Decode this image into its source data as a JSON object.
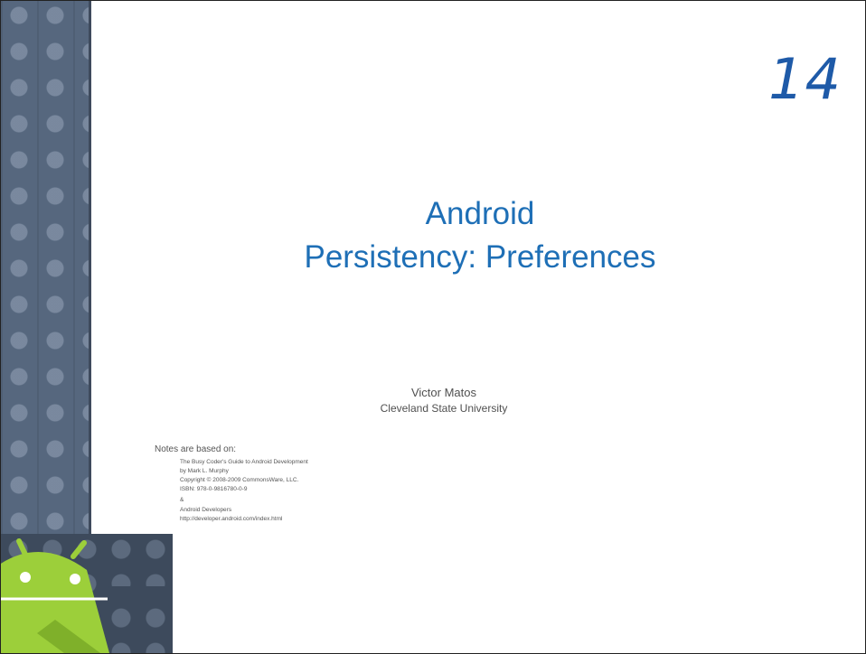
{
  "slide_number": "14",
  "title_line1": "Android",
  "title_line2": "Persistency:  Preferences",
  "author": "Victor Matos",
  "affiliation": "Cleveland State University",
  "notes_heading": "Notes are based on:",
  "notes_lines": [
    "The Busy Coder's Guide to Android Development",
    "by Mark L. Murphy",
    "Copyright © 2008-2009 CommonsWare, LLC.",
    "ISBN: 978-0-9816780-0-9",
    "&",
    "Android Developers",
    "http://developer.android.com/index.html"
  ],
  "logo_text": "android",
  "colors": {
    "title": "#1e6fb6",
    "number": "#1e5aa8",
    "strip": "#56677e",
    "android_green": "#9ccf3a"
  }
}
